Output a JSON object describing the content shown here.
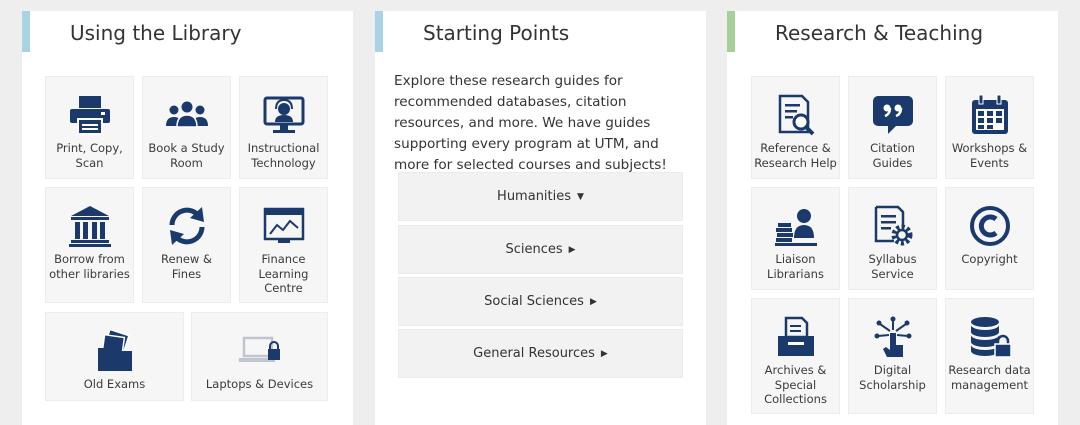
{
  "library": {
    "title": "Using the Library",
    "tiles": [
      {
        "label": "Print, Copy, Scan",
        "icon": "printer-icon"
      },
      {
        "label": "Book a Study Room",
        "icon": "group-icon"
      },
      {
        "label": "Instructional Technology",
        "icon": "tech-support-icon"
      },
      {
        "label": "Borrow from other libraries",
        "icon": "institution-icon"
      },
      {
        "label": "Renew & Fines",
        "icon": "refresh-icon"
      },
      {
        "label": "Finance Learning Centre",
        "icon": "chart-screen-icon"
      },
      {
        "label": "Old Exams",
        "icon": "folder-icon"
      },
      {
        "label": "Laptops & Devices",
        "icon": "laptop-lock-icon"
      }
    ]
  },
  "starting": {
    "title": "Starting Points",
    "intro": "Explore these research guides for recommended databases, citation resources, and more. We have guides supporting every program at UTM, and more for selected courses and subjects!",
    "accordion": [
      {
        "label": "Humanities",
        "arrow": "▼"
      },
      {
        "label": "Sciences",
        "arrow": "▶"
      },
      {
        "label": "Social Sciences",
        "arrow": "▶"
      },
      {
        "label": "General Resources",
        "arrow": "▶"
      }
    ]
  },
  "research": {
    "title": "Research & Teaching",
    "tiles": [
      {
        "label": "Reference & Research Help",
        "icon": "document-search-icon"
      },
      {
        "label": "Citation Guides",
        "icon": "quote-icon"
      },
      {
        "label": "Workshops & Events",
        "icon": "calendar-icon"
      },
      {
        "label": "Liaison Librarians",
        "icon": "librarian-icon"
      },
      {
        "label": "Syllabus Service",
        "icon": "syllabus-gear-icon"
      },
      {
        "label": "Copyright",
        "icon": "copyright-icon"
      },
      {
        "label": "Archives & Special Collections",
        "icon": "archive-box-icon"
      },
      {
        "label": "Digital Scholarship",
        "icon": "digital-touch-icon"
      },
      {
        "label": "Research data management",
        "icon": "database-lock-icon"
      }
    ]
  },
  "colors": {
    "icon": "#1b3a6b",
    "bar_blue": "#a9d3e4",
    "bar_green": "#a6d09a"
  }
}
